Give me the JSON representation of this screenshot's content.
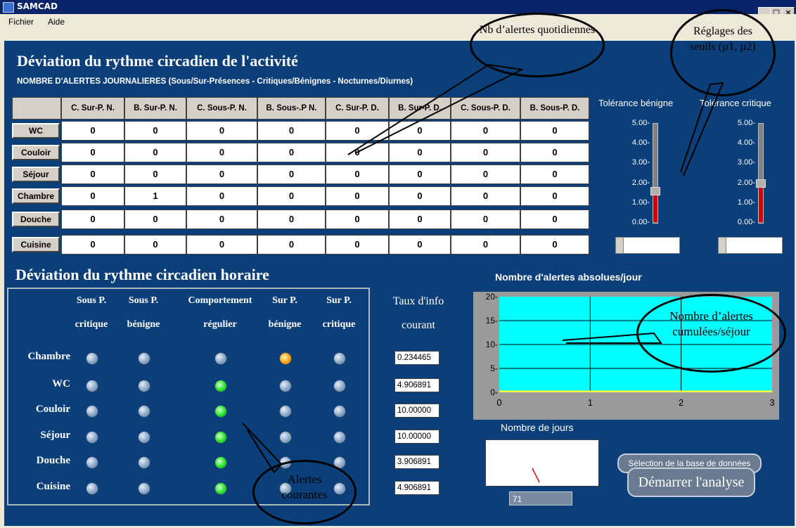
{
  "window": {
    "title": "SAMCAD",
    "min": "_",
    "max": "□",
    "close": "×"
  },
  "menu": {
    "file": "Fichier",
    "help": "Aide"
  },
  "section1": {
    "title": "Déviation du rythme circadien de l'activité",
    "subtitle": "NOMBRE D'ALERTES JOURNALIERES (Sous/Sur-Présences - Critiques/Bénignes - Nocturnes/Diurnes)"
  },
  "table": {
    "columns": [
      "C. Sur-P. N.",
      "B. Sur-P. N.",
      "C. Sous-P. N.",
      "B. Sous-.P N.",
      "C. Sur-P. D.",
      "B. Sur-P. D.",
      "C. Sous-P. D.",
      "B. Sous-P. D."
    ],
    "rows": [
      {
        "label": "WC",
        "values": [
          "0",
          "0",
          "0",
          "0",
          "0",
          "0",
          "0",
          "0"
        ]
      },
      {
        "label": "Couloir",
        "values": [
          "0",
          "0",
          "0",
          "0",
          "0",
          "0",
          "0",
          "0"
        ]
      },
      {
        "label": "Séjour",
        "values": [
          "0",
          "0",
          "0",
          "0",
          "0",
          "0",
          "0",
          "0"
        ]
      },
      {
        "label": "Chambre",
        "values": [
          "0",
          "1",
          "0",
          "0",
          "0",
          "0",
          "0",
          "0"
        ]
      },
      {
        "label": "Douche",
        "values": [
          "0",
          "0",
          "0",
          "0",
          "0",
          "0",
          "0",
          "0"
        ]
      },
      {
        "label": "Cuisine",
        "values": [
          "0",
          "0",
          "0",
          "0",
          "0",
          "0",
          "0",
          "0"
        ]
      }
    ]
  },
  "tolerance": {
    "benign": {
      "label": "Tolérance bénigne",
      "level": 1.6,
      "value": ""
    },
    "critical": {
      "label": "Tolérance critique",
      "level": 2.0,
      "value": ""
    },
    "scale": [
      "5.00-",
      "4.00-",
      "3.00-",
      "2.00-",
      "1.00-",
      "0.00-"
    ]
  },
  "section2": {
    "title": "Déviation du rythme circadien horaire",
    "col_headers": [
      {
        "l1": "Sous P.",
        "l2": "critique"
      },
      {
        "l1": "Sous P.",
        "l2": "bénigne"
      },
      {
        "l1": "Comportement",
        "l2": "régulier"
      },
      {
        "l1": "Sur P.",
        "l2": "bénigne"
      },
      {
        "l1": "Sur P.",
        "l2": "critique"
      }
    ],
    "rate_header": {
      "l1": "Taux d'info",
      "l2": "courant"
    },
    "rows": [
      {
        "label": "Chambre",
        "states": [
          "off",
          "off",
          "off",
          "orange",
          "off"
        ],
        "rate": "0.234465"
      },
      {
        "label": "WC",
        "states": [
          "off",
          "off",
          "green",
          "off",
          "off"
        ],
        "rate": "4.906891"
      },
      {
        "label": "Couloir",
        "states": [
          "off",
          "off",
          "green",
          "off",
          "off"
        ],
        "rate": "10.00000"
      },
      {
        "label": "Séjour",
        "states": [
          "off",
          "off",
          "green",
          "off",
          "off"
        ],
        "rate": "10.00000"
      },
      {
        "label": "Douche",
        "states": [
          "off",
          "off",
          "green",
          "off",
          "off"
        ],
        "rate": "3.906891"
      },
      {
        "label": "Cuisine",
        "states": [
          "off",
          "off",
          "green",
          "off",
          "off"
        ],
        "rate": "4.906891"
      }
    ]
  },
  "chart_data": {
    "type": "line",
    "title": "Nombre d'alertes absolues/jour",
    "x_ticks": [
      "0",
      "1",
      "2",
      "3"
    ],
    "y_ticks": [
      "20-",
      "15-",
      "10-",
      "5-",
      "0-"
    ],
    "xlim": [
      0,
      3
    ],
    "ylim": [
      0,
      20
    ],
    "series": [
      {
        "x": [
          0,
          3
        ],
        "y": [
          0,
          0
        ]
      }
    ],
    "grid": true
  },
  "days": {
    "label": "Nombre de jours",
    "value": "71"
  },
  "buttons": {
    "select_db": "Sélection de la base de données",
    "start": "Démarrer l'analyse"
  },
  "annotations": {
    "a1": "Nb d’alertes quotidiennes",
    "a2": "Réglages des seuils (µ1, µ2)",
    "a3": "Nombre d’alertes cumulées/séjour",
    "a4": "Alertes courantes"
  },
  "colors": {
    "panel": "#0b3f7a",
    "plot": "#00ffff",
    "led_green": "#2ee82e",
    "led_orange": "#ffaa20",
    "slider_fill": "#d40000"
  }
}
